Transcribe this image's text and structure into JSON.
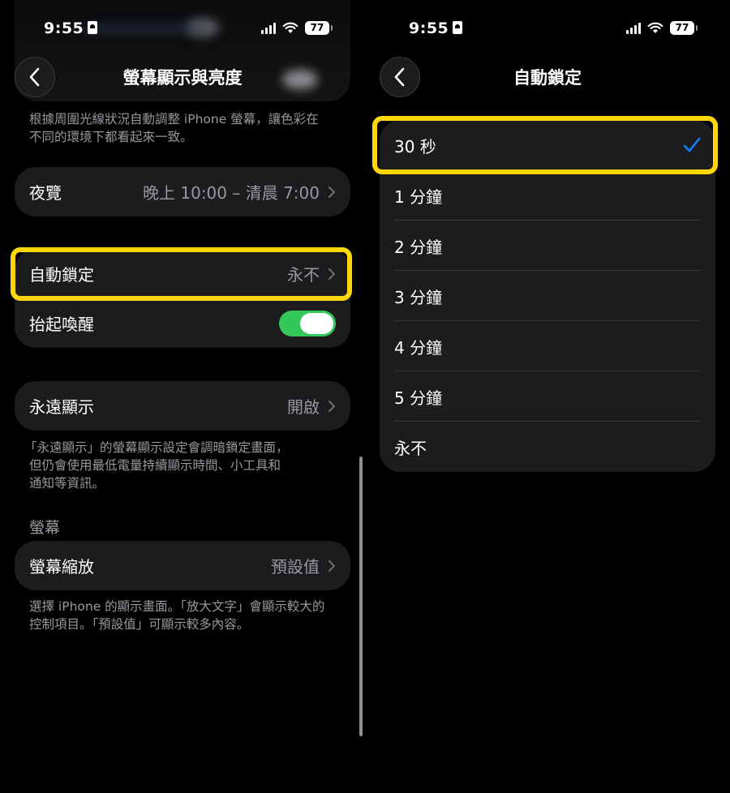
{
  "status_bar": {
    "time": "9:55",
    "battery": "77"
  },
  "left": {
    "nav_title": "螢幕顯示與亮度",
    "truetone_footnote_lines": [
      "根據周圍光線狀況自動調整 iPhone 螢幕，讓色彩在",
      "不同的環境下都看起來一致。"
    ],
    "night_shift": {
      "label": "夜覽",
      "value": "晚上 10:00 – 清晨 7:00"
    },
    "auto_lock": {
      "label": "自動鎖定",
      "value": "永不"
    },
    "raise_to_wake": {
      "label": "抬起喚醒"
    },
    "always_on": {
      "label": "永遠顯示",
      "value": "開啟"
    },
    "always_on_footnote_lines": [
      "「永遠顯示」的螢幕顯示設定會調暗鎖定畫面，",
      "但仍會使用最低電量持續顯示時間、小工具和",
      "通知等資訊。"
    ],
    "display_section_header": "螢幕",
    "display_zoom": {
      "label": "螢幕縮放",
      "value": "預設值"
    },
    "zoom_footnote_lines": [
      "選擇 iPhone 的顯示畫面。「放大文字」會顯示較大的",
      "控制項目。「預設值」可顯示較多內容。"
    ]
  },
  "right": {
    "nav_title": "自動鎖定",
    "options": [
      "30 秒",
      "1 分鐘",
      "2 分鐘",
      "3 分鐘",
      "4 分鐘",
      "5 分鐘",
      "永不"
    ],
    "selected_option": "30 秒"
  },
  "colors": {
    "highlight": "#ffd60a",
    "toggle_on": "#34c759",
    "checkmark": "#0a84ff",
    "cell": "#1c1c1e"
  }
}
